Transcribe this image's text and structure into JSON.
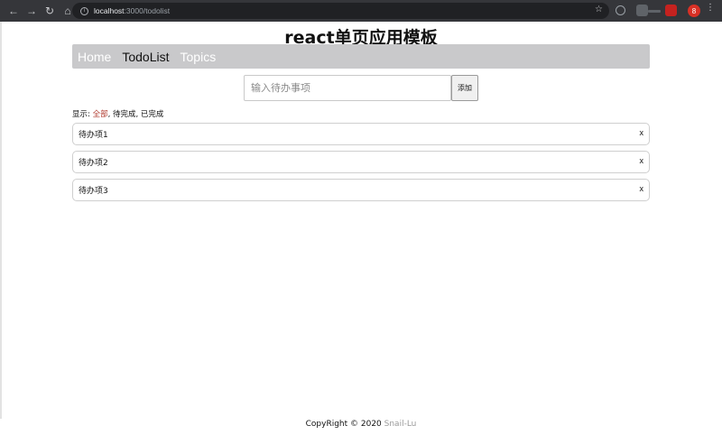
{
  "browser": {
    "url_host": "localhost",
    "url_rest": ":3000/todolist",
    "avatar_letter": "8",
    "back_icon": "arrow-left-icon",
    "forward_icon": "arrow-right-icon",
    "reload_icon": "reload-icon",
    "home_icon": "home-icon",
    "star_icon": "star-icon"
  },
  "page": {
    "title": "react单页应用模板"
  },
  "nav": {
    "items": [
      {
        "label": "Home"
      },
      {
        "label": "TodoList"
      },
      {
        "label": "Topics"
      }
    ],
    "active": "TodoList"
  },
  "add": {
    "placeholder": "输入待办事项",
    "button_label": "添加"
  },
  "filter": {
    "prefix": "显示:",
    "options": [
      "全部",
      "待完成",
      "已完成"
    ],
    "active": "全部",
    "active_color": "#b03a2e"
  },
  "todos": [
    {
      "text": "待办项1",
      "delete": "x"
    },
    {
      "text": "待办项2",
      "delete": "x"
    },
    {
      "text": "待办项3",
      "delete": "x"
    }
  ],
  "footer": {
    "copyright": "CopyRight © 2020 ",
    "author": "Snail-Lu"
  }
}
